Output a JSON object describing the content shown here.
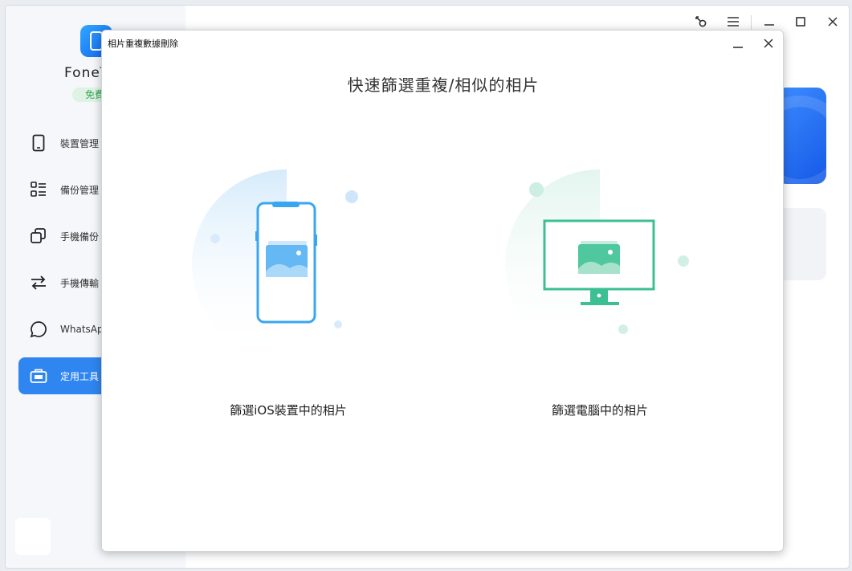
{
  "app": {
    "name": "FoneT",
    "badge": "免費",
    "colors": {
      "accent": "#2f86f0",
      "green": "#3dbf94",
      "blue": "#3aa6f0"
    }
  },
  "sidebar": {
    "items": [
      {
        "label": "裝置管理",
        "icon": "phone-icon",
        "active": false
      },
      {
        "label": "備份管理",
        "icon": "list-icon",
        "active": false
      },
      {
        "label": "手機備份",
        "icon": "copy-icon",
        "active": false
      },
      {
        "label": "手機傳輸",
        "icon": "transfer-icon",
        "active": false
      },
      {
        "label": "WhatsApp",
        "icon": "chat-icon",
        "active": false
      },
      {
        "label": "定用工具",
        "icon": "toolbox-icon",
        "active": true
      }
    ]
  },
  "window_controls": [
    "key-icon",
    "menu-icon",
    "minimize-icon",
    "maximize-icon",
    "close-icon"
  ],
  "modal": {
    "title": "相片重複數據刪除",
    "headline": "快速篩選重複/相似的相片",
    "options": [
      {
        "label": "篩選iOS裝置中的相片",
        "icon": "iphone-photos-icon"
      },
      {
        "label": "篩選電腦中的相片",
        "icon": "monitor-photos-icon"
      }
    ]
  }
}
